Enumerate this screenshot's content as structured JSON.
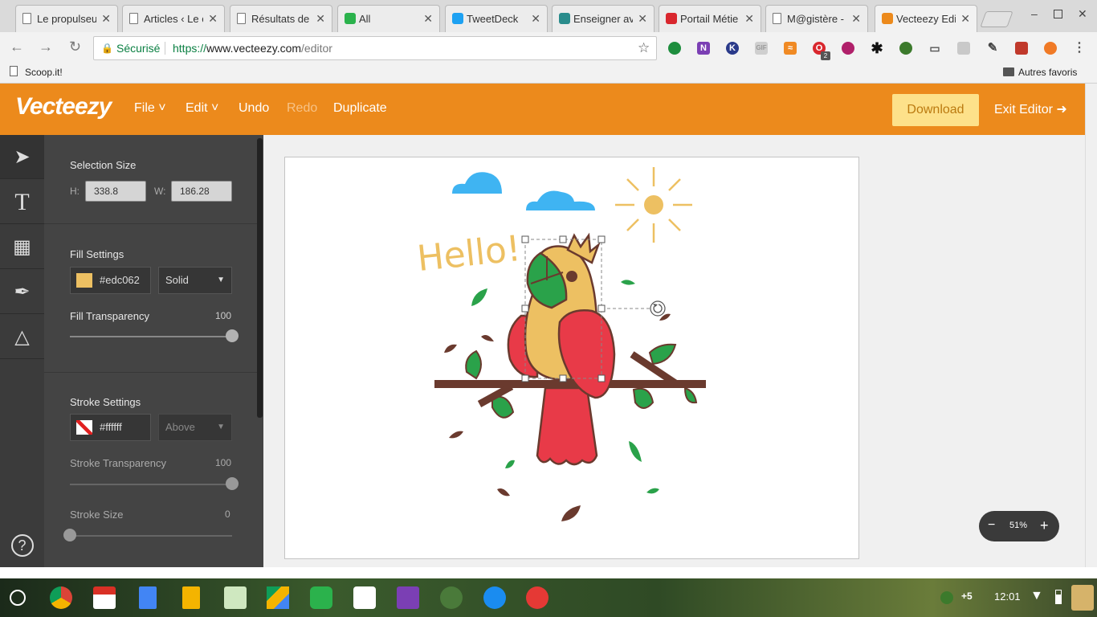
{
  "browser": {
    "tabs": [
      {
        "label": "Le propulseu",
        "icon": "page-icon",
        "color": "#888888"
      },
      {
        "label": "Articles ‹ Le c",
        "icon": "page-icon",
        "color": "#888888"
      },
      {
        "label": "Résultats de",
        "icon": "page-icon",
        "color": "#888888"
      },
      {
        "label": "All",
        "icon": "feedly-icon",
        "color": "#2bb24c"
      },
      {
        "label": "TweetDeck",
        "icon": "twitter-icon",
        "color": "#1da1f2"
      },
      {
        "label": "Enseigner av",
        "icon": "e-icon",
        "color": "#2a8c8c"
      },
      {
        "label": "Portail Métie",
        "icon": "e-red-icon",
        "color": "#d9272e"
      },
      {
        "label": "M@gistère - /",
        "icon": "page-icon",
        "color": "#888888"
      },
      {
        "label": "Vecteezy Edi",
        "icon": "vecteezy-icon",
        "color": "#ec8a1c",
        "active": true
      }
    ],
    "secure_label": "Sécurisé",
    "url_scheme": "https://",
    "url_host": "www.vecteezy.com",
    "url_path": "/editor",
    "bookmark_left": "Scoop.it!",
    "bookmark_right": "Autres favoris",
    "ext_badge": "2"
  },
  "app": {
    "logo": "Vecteezy",
    "menu": {
      "file": "File",
      "edit": "Edit",
      "undo": "Undo",
      "redo": "Redo",
      "duplicate": "Duplicate"
    },
    "download": "Download",
    "exit": "Exit Editor",
    "accent": "#ec8a1c"
  },
  "panel": {
    "selection": {
      "title": "Selection Size",
      "h_label": "H:",
      "h_value": "338.8",
      "w_label": "W:",
      "w_value": "186.28"
    },
    "fill": {
      "title": "Fill Settings",
      "color_hex": "#edc062",
      "type": "Solid",
      "transparency_label": "Fill Transparency",
      "transparency_value": "100",
      "level": 1.0
    },
    "stroke": {
      "title": "Stroke Settings",
      "color_hex": "#ffffff",
      "position": "Above",
      "transparency_label": "Stroke Transparency",
      "transparency_value": "100",
      "transparency_level": 1.0,
      "size_label": "Stroke Size",
      "size_value": "0",
      "size_level": 0.0
    }
  },
  "canvas": {
    "greeting": "Hello!",
    "zoom": "51%",
    "zoom_minus": "−",
    "zoom_plus": "+"
  },
  "shelf": {
    "badge": "+5",
    "time": "12:01"
  }
}
